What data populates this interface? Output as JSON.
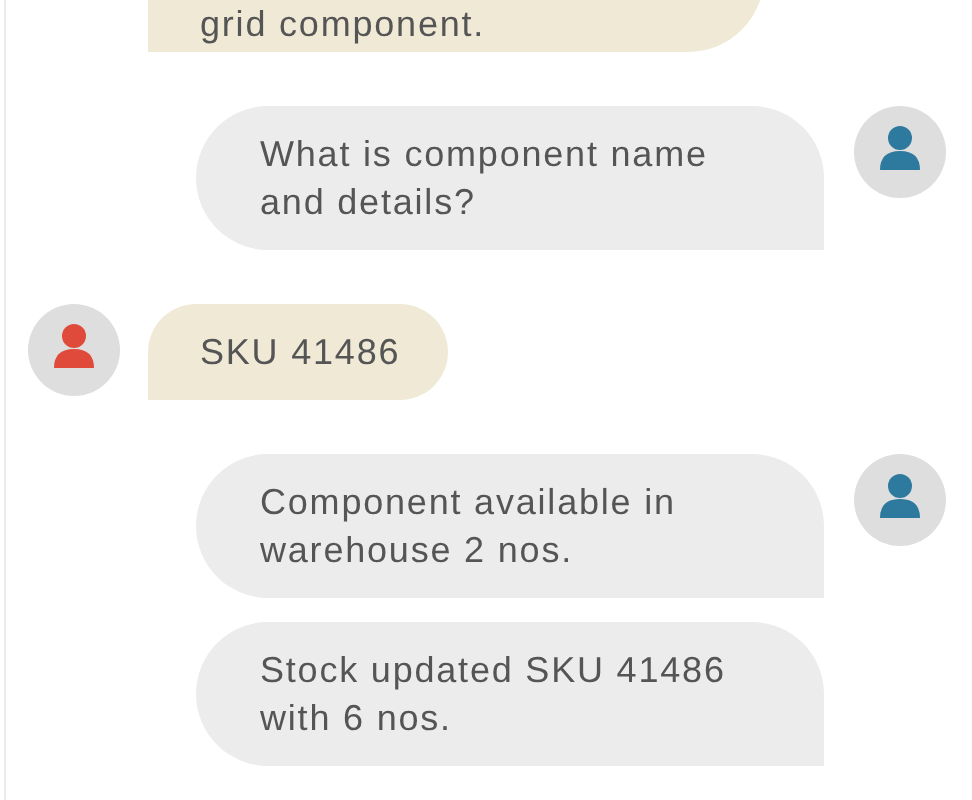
{
  "messages": [
    {
      "kind": "bot",
      "show_avatar": false,
      "text": "grid component."
    },
    {
      "kind": "user",
      "show_avatar": true,
      "text": "What is component name and details?"
    },
    {
      "kind": "bot",
      "show_avatar": true,
      "text": "SKU 41486"
    },
    {
      "kind": "user",
      "show_avatar": true,
      "text": "Component available in warehouse 2 nos."
    },
    {
      "kind": "user",
      "show_avatar": false,
      "text": "Stock updated SKU 41486 with 6 nos."
    }
  ]
}
